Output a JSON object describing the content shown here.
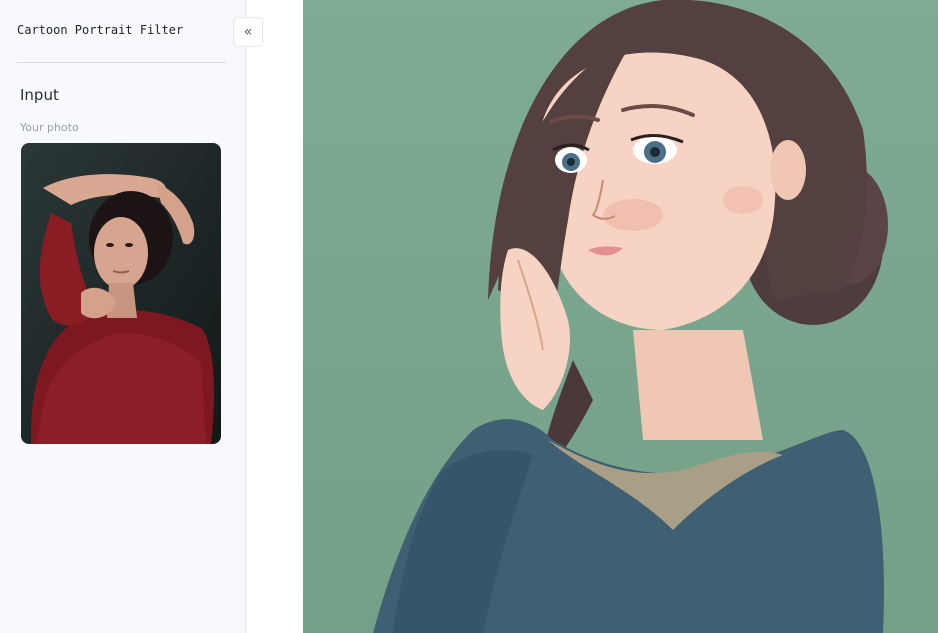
{
  "sidebar": {
    "app_title": "Cartoon Portrait Filter",
    "collapse_icon": "chevron-double-left-icon",
    "collapse_glyph": "«",
    "section_title": "Input",
    "photo_label": "Your photo"
  },
  "colors": {
    "sidebar_bg": "#f7f9fc",
    "output_bg": "#7aa58d",
    "photo_bg": "#1f2a2a",
    "sweater": "#3f5f72",
    "red_top": "#8a1c24"
  }
}
